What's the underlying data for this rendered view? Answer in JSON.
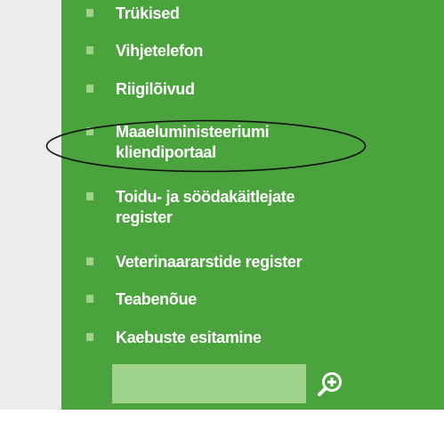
{
  "nav": {
    "items": [
      {
        "label": "Trükised"
      },
      {
        "label": "Vihjetelefon"
      },
      {
        "label": "Riigilõivud"
      },
      {
        "label": "Maaeluministeeriumi kliendiportaal"
      },
      {
        "label": "Toidu- ja söödakäitlejate register"
      },
      {
        "label": "Veterinaararstide register"
      },
      {
        "label": "Teabenõue"
      },
      {
        "label": "Kaebuste esitamine"
      }
    ]
  },
  "search": {
    "value": "",
    "button_icon": "zoom-in-icon"
  },
  "colors": {
    "panel": "#4aa33c",
    "bullet": "#9fd28a",
    "input": "#9fd28a",
    "gutter": "#ececec",
    "text": "#ffffff"
  }
}
